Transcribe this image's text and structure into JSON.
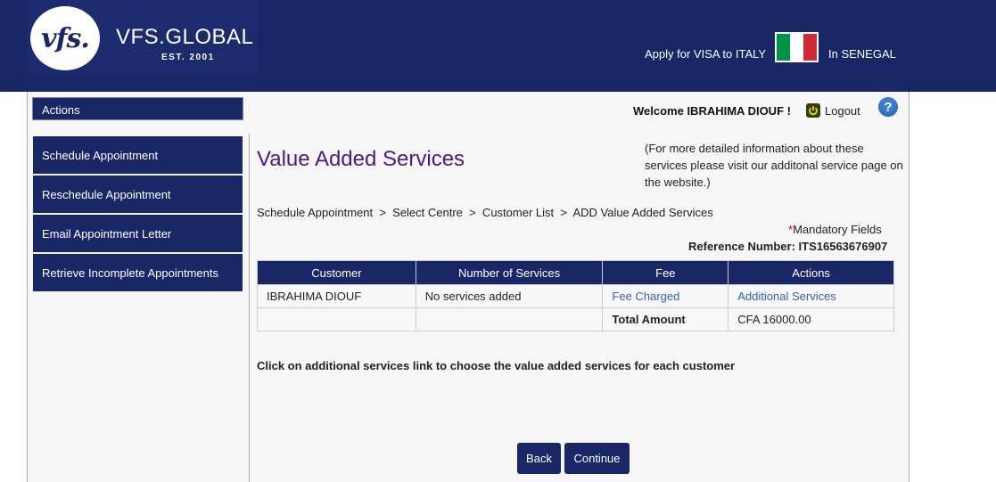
{
  "header": {
    "logo_mark": "vfs.",
    "brand_name": "VFS.GLOBAL",
    "brand_est": "EST. 2001",
    "apply_text": "Apply for VISA to ITALY",
    "country_text": "In SENEGAL",
    "flag_colors": [
      "#009246",
      "#ffffff",
      "#ce2b37"
    ]
  },
  "sidebar": {
    "title": "Actions",
    "items": [
      {
        "label": "Schedule Appointment"
      },
      {
        "label": "Reschedule Appointment"
      },
      {
        "label": "Email Appointment Letter"
      },
      {
        "label": "Retrieve Incomplete Appointments"
      }
    ]
  },
  "topbar": {
    "welcome": "Welcome IBRAHIMA DIOUF !",
    "logout": "Logout",
    "help": "?"
  },
  "main": {
    "title": "Value Added Services",
    "info": "(For more detailed information about these services please visit our additonal service page on the website.)",
    "breadcrumb": "Schedule Appointment  >  Select Centre  >  Customer List  >  ADD Value Added Services",
    "mandatory_star": "*",
    "mandatory_text": "Mandatory Fields",
    "reference": "Reference Number: ITS16563676907",
    "table": {
      "headers": [
        "Customer",
        "Number of Services",
        "Fee",
        "Actions"
      ],
      "row1": {
        "customer": "IBRAHIMA DIOUF",
        "services": "No services added",
        "fee": "Fee Charged",
        "action": "Additional Services"
      },
      "row2": {
        "customer": "",
        "services": "",
        "fee": "Total Amount",
        "action": "CFA 16000.00"
      }
    },
    "hint": "Click on additional services link to choose the value added services for each customer",
    "back": "Back",
    "continue": "Continue"
  },
  "colors": {
    "brand_navy": "#1a2766",
    "title_purple": "#4a1a80",
    "link_blue": "#3560b5"
  }
}
